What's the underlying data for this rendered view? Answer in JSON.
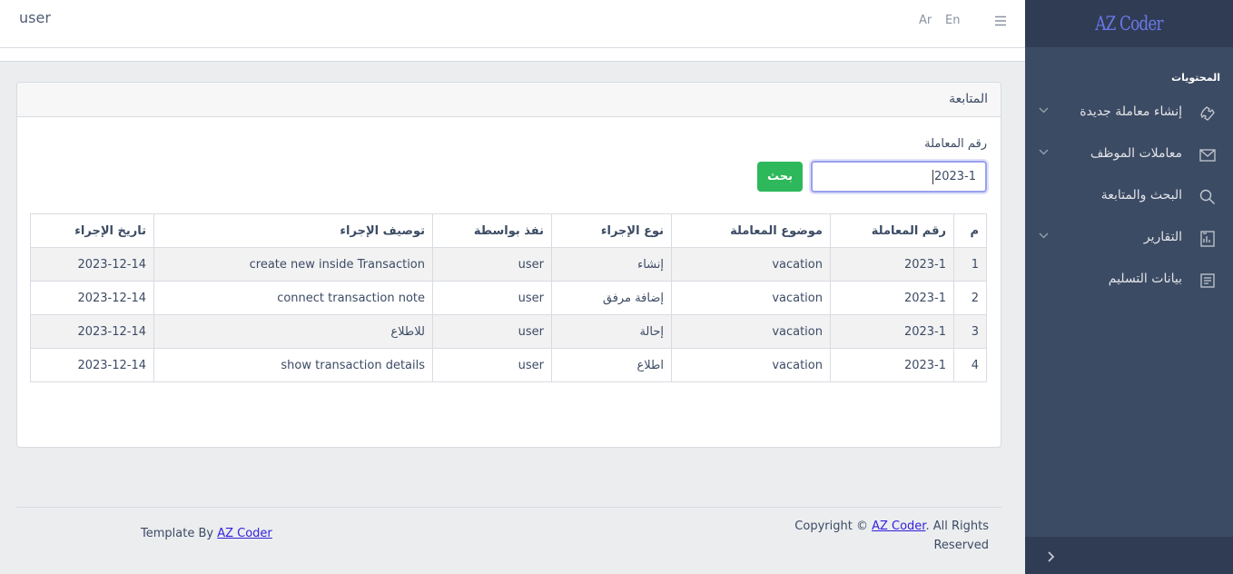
{
  "header": {
    "user": "user",
    "lang_ar": "Ar",
    "lang_en": "En"
  },
  "sidebar": {
    "brand": "AZ Coder",
    "section_title": "المحتويات",
    "items": [
      {
        "label": "إنشاء معاملة جديدة",
        "icon": "puzzle-icon",
        "has_caret": true
      },
      {
        "label": "معاملات الموظف",
        "icon": "envelope-icon",
        "has_caret": true
      },
      {
        "label": "البحث والمتابعة",
        "icon": "search-icon",
        "has_caret": false
      },
      {
        "label": "التقارير",
        "icon": "report-icon",
        "has_caret": true
      },
      {
        "label": "بيانات التسليم",
        "icon": "document-icon",
        "has_caret": false
      }
    ]
  },
  "card": {
    "title": "المتابعة",
    "field_label": "رقم المعاملة",
    "search_value": "2023-1",
    "search_button": "بحث"
  },
  "table": {
    "headers": [
      "م",
      "رقم المعاملة",
      "موضوع المعاملة",
      "نوع الإجراء",
      "نفذ بواسطة",
      "توصيف الإجراء",
      "تاريخ الإجراء"
    ],
    "rows": [
      [
        "1",
        "2023-1",
        "vacation",
        "إنشاء",
        "user",
        "create new inside Transaction",
        "2023-12-14"
      ],
      [
        "2",
        "2023-1",
        "vacation",
        "إضافة مرفق",
        "user",
        "connect transaction note",
        "2023-12-14"
      ],
      [
        "3",
        "2023-1",
        "vacation",
        "إحالة",
        "user",
        "للاطلاع",
        "2023-12-14"
      ],
      [
        "4",
        "2023-1",
        "vacation",
        "اطلاع",
        "user",
        "show transaction details",
        "2023-12-14"
      ]
    ]
  },
  "footer": {
    "template_prefix": "Template By ",
    "template_link": "AZ Coder",
    "copyright_prefix": "Copyright © ",
    "copyright_link": "AZ Coder",
    "copyright_suffix": ". All Rights Reserved"
  },
  "colors": {
    "sidebar_bg": "#3c4b64",
    "sidebar_dark": "#303c54",
    "brand_text": "#6a78e8",
    "success": "#2eb85c",
    "link": "#321fdb",
    "page_bg": "#ebedef"
  }
}
